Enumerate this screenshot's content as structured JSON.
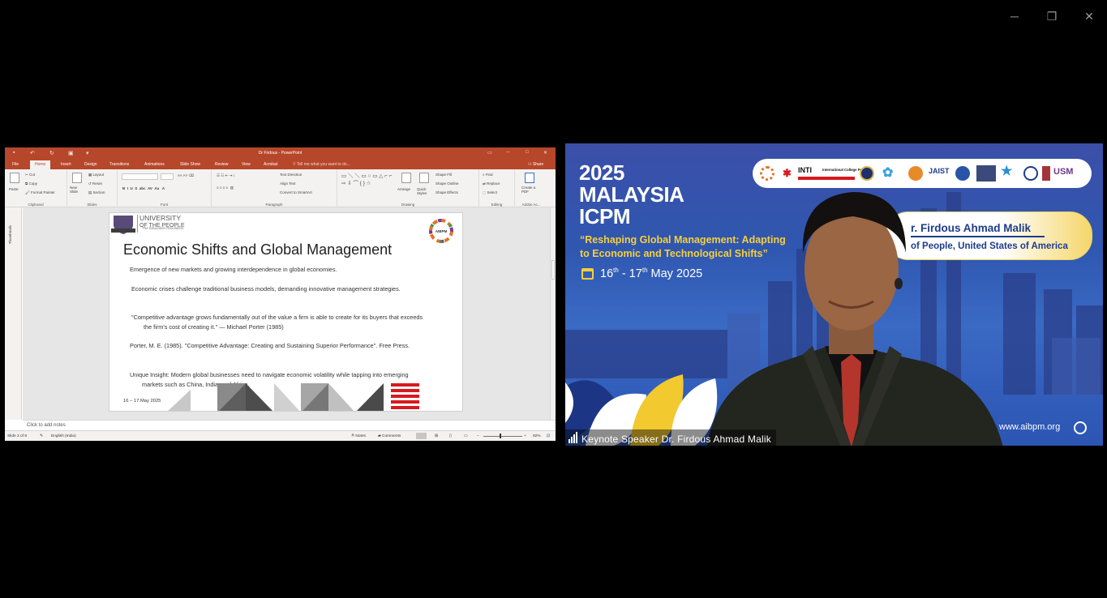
{
  "window": {
    "minimize_icon": "─",
    "restore_icon": "❐",
    "close_icon": "✕"
  },
  "ppt": {
    "doc_title": "Dr Firdous - PowerPoint",
    "tabs": [
      "File",
      "Home",
      "Insert",
      "Design",
      "Transitions",
      "Animations",
      "Slide Show",
      "Review",
      "View",
      "Acrobat"
    ],
    "tell_me": "Tell me what you want to do...",
    "share": "Share",
    "ribbon": {
      "paste": "Paste",
      "cut": "Cut",
      "copy": "Copy",
      "format_painter": "Format Painter",
      "clipboard": "Clipboard",
      "new_slide": "New Slide",
      "layout": "Layout",
      "reset": "Reset",
      "section": "Section",
      "slides": "Slides",
      "font": "Font",
      "text_direction": "Text Direction",
      "align_text": "Align Text",
      "convert_smartart": "Convert to SmartArt",
      "paragraph": "Paragraph",
      "arrange": "Arrange",
      "quick_styles": "Quick Styles",
      "shape_fill": "Shape Fill",
      "shape_outline": "Shape Outline",
      "shape_effects": "Shape Effects",
      "drawing": "Drawing",
      "find": "Find",
      "replace": "Replace",
      "select": "Select",
      "editing": "Editing",
      "create_pdf": "Create a PDF",
      "adobe": "Adobe Ac..."
    },
    "thumbnails": "Thumbnails",
    "slide": {
      "uni_name_1": "UNIVERSITY",
      "uni_name_2": "OF THE PEOPLE",
      "uni_tagline": "The Education Revolution",
      "logo_text": "AIBPM",
      "title": "Economic Shifts and Global Management",
      "bullets": [
        "Emergence of new markets and growing interdependence in global economies.",
        "Economic crises challenge traditional business models, demanding innovative management strategies.",
        "\"Competitive advantage grows fundamentally out of the value a firm is able to create for its buyers that exceeds the firm's cost of creating it.\" — Michael Porter (1985)",
        "Porter, M. E. (1985). \"Competitive Advantage: Creating and Sustaining Superior Performance\". Free Press.",
        "Unique Insight: Modern global businesses need to navigate economic volatility while tapping into emerging markets such as China, India, and Africa."
      ],
      "date": "16 – 17 May 2025"
    },
    "notes_placeholder": "Click to add notes",
    "status": {
      "slide_count": "Slide 3 of 8",
      "language": "English (India)",
      "notes": "Notes",
      "comments": "Comments",
      "zoom": "92%"
    },
    "colors": {
      "accent": "#b7472a"
    }
  },
  "video": {
    "event_title": [
      "2025",
      "MALAYSIA",
      "ICPM"
    ],
    "theme_line1": "“Reshaping Global Management: Adapting",
    "theme_line2": "to Economic and Technological Shifts”",
    "date_start": "16",
    "date_start_sup": "th",
    "date_sep": " - ",
    "date_end": "17",
    "date_end_sup": "th",
    "date_tail": " May 2025",
    "partner_inti": "INTI",
    "partner_inti_sub": "International College Penang",
    "partner_jaist": "JAIST",
    "partner_usm": "USM",
    "speaker_name": "r. Firdous Ahmad Malik",
    "speaker_affil": "of People, United States of America",
    "website": "www.aibpm.org",
    "caption": "Keynote Speaker Dr. Firdous Ahmad Malik",
    "colors": {
      "title": "#ffffff",
      "theme": "#f7cf3a",
      "name": "#1e3c8c"
    }
  }
}
